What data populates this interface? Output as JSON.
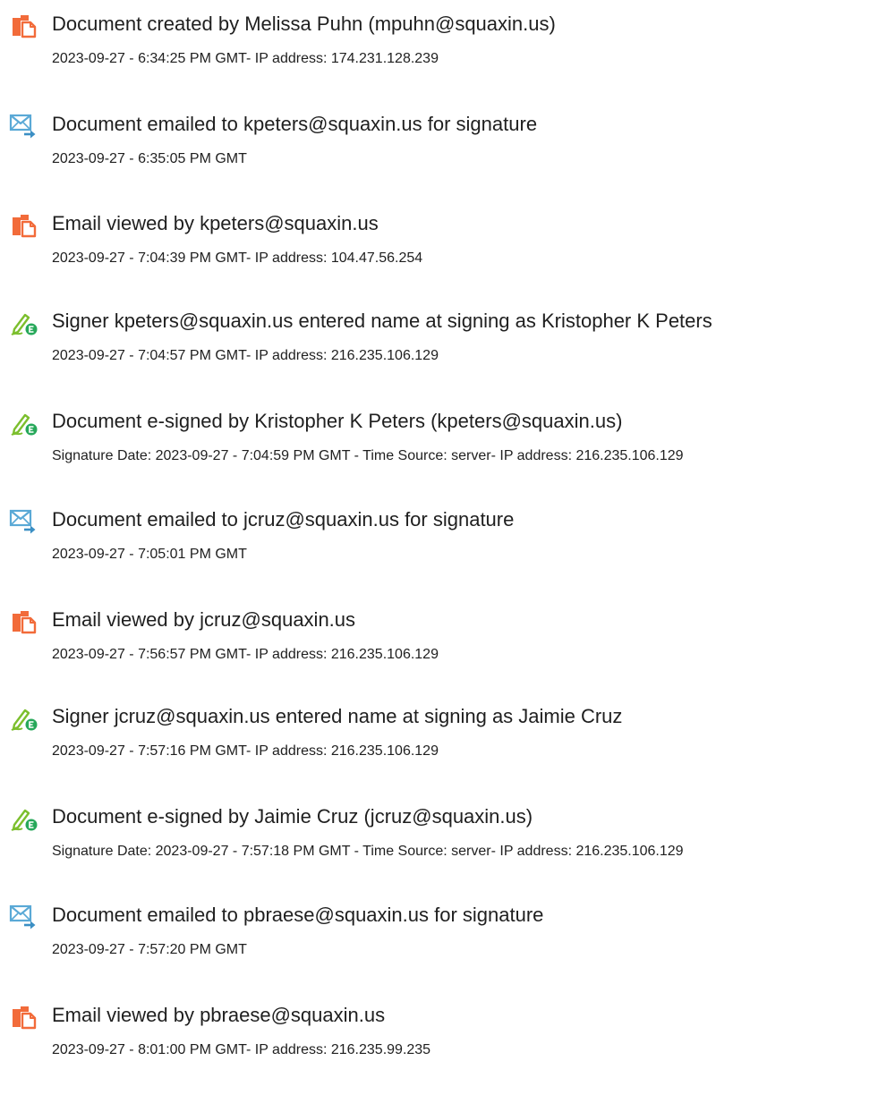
{
  "colors": {
    "doc_icon": "#f26b3a",
    "email_icon": "#5aa9d6",
    "sign_icon": "#7cbf2d",
    "sign_badge": "#27a85a"
  },
  "events": [
    {
      "icon": "document-icon",
      "title": "Document created by Melissa Puhn (mpuhn@squaxin.us)",
      "detail": "2023-09-27 - 6:34:25 PM GMT- IP address: 174.231.128.239"
    },
    {
      "icon": "email-icon",
      "title": "Document emailed to kpeters@squaxin.us for signature",
      "detail": "2023-09-27 - 6:35:05 PM GMT"
    },
    {
      "icon": "document-icon",
      "title": "Email viewed by kpeters@squaxin.us",
      "detail": "2023-09-27 - 7:04:39 PM GMT- IP address: 104.47.56.254"
    },
    {
      "icon": "signature-icon",
      "title": "Signer kpeters@squaxin.us entered name at signing as Kristopher K Peters",
      "detail": "2023-09-27 - 7:04:57 PM GMT- IP address: 216.235.106.129"
    },
    {
      "icon": "signature-icon",
      "title": "Document e-signed by Kristopher K Peters (kpeters@squaxin.us)",
      "detail": "Signature Date: 2023-09-27 - 7:04:59 PM GMT - Time Source: server- IP address: 216.235.106.129"
    },
    {
      "icon": "email-icon",
      "title": "Document emailed to jcruz@squaxin.us for signature",
      "detail": "2023-09-27 - 7:05:01 PM GMT"
    },
    {
      "icon": "document-icon",
      "title": "Email viewed by jcruz@squaxin.us",
      "detail": "2023-09-27 - 7:56:57 PM GMT- IP address: 216.235.106.129"
    },
    {
      "icon": "signature-icon",
      "title": "Signer jcruz@squaxin.us entered name at signing as Jaimie Cruz",
      "detail": "2023-09-27 - 7:57:16 PM GMT- IP address: 216.235.106.129"
    },
    {
      "icon": "signature-icon",
      "title": "Document e-signed by Jaimie Cruz (jcruz@squaxin.us)",
      "detail": "Signature Date: 2023-09-27 - 7:57:18 PM GMT - Time Source: server- IP address: 216.235.106.129"
    },
    {
      "icon": "email-icon",
      "title": "Document emailed to pbraese@squaxin.us for signature",
      "detail": "2023-09-27 - 7:57:20 PM GMT"
    },
    {
      "icon": "document-icon",
      "title": "Email viewed by pbraese@squaxin.us",
      "detail": "2023-09-27 - 8:01:00 PM GMT- IP address: 216.235.99.235"
    }
  ]
}
